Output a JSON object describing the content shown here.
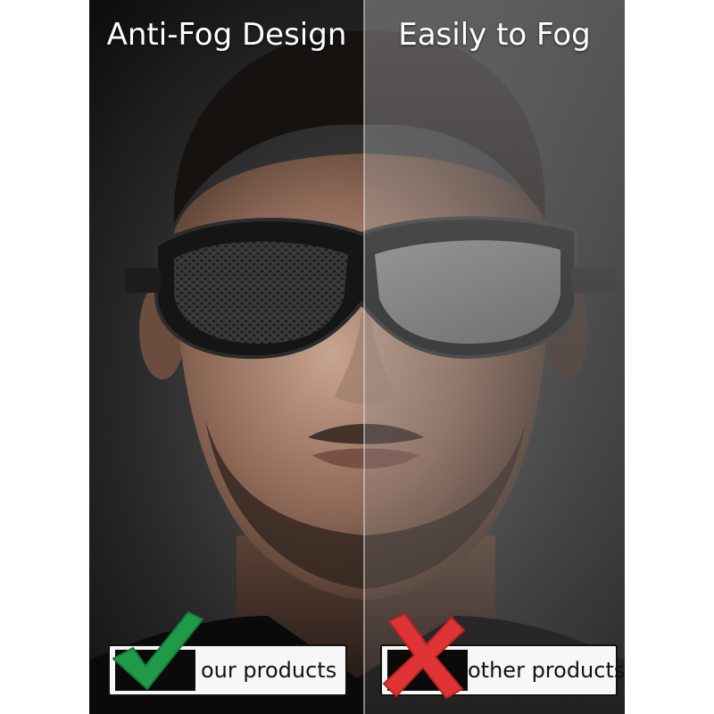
{
  "headings": {
    "left": "Anti-Fog Design",
    "right": "Easily to Fog"
  },
  "badges": {
    "left": {
      "label": "our products",
      "icon": "check-icon",
      "color": "#1f9a49"
    },
    "right": {
      "label": "other products",
      "icon": "x-icon",
      "color": "#e03434"
    }
  },
  "colors": {
    "background": "#0c0c0c",
    "text": "#ffffff",
    "badge_bg": "#f7f7f7"
  }
}
